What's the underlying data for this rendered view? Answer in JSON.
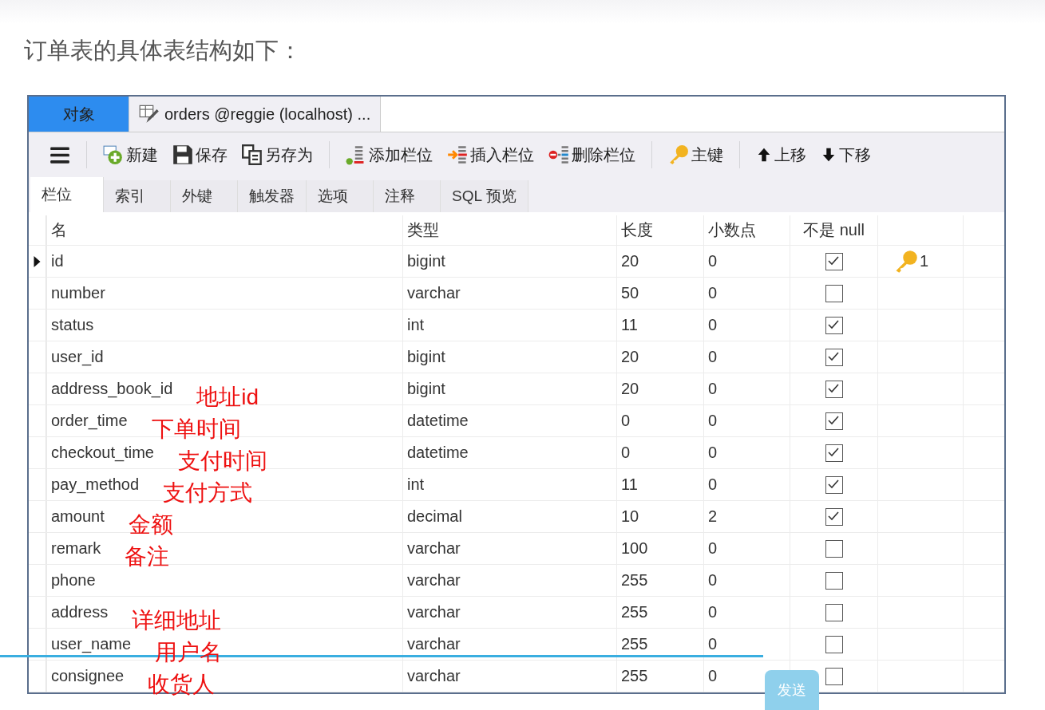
{
  "heading": "订单表的具体表结构如下：",
  "window": {
    "tabs": [
      {
        "label": "对象",
        "selected": true,
        "kind": "plain"
      },
      {
        "label": "orders @reggie (localhost) ...",
        "selected": false,
        "kind": "design"
      }
    ],
    "toolbar_groups": [
      [
        {
          "kind": "menu"
        }
      ],
      [
        {
          "kind": "new",
          "label": "新建"
        },
        {
          "kind": "save",
          "label": "保存"
        },
        {
          "kind": "saveas",
          "label": "另存为"
        }
      ],
      [
        {
          "kind": "addcol",
          "label": "添加栏位"
        },
        {
          "kind": "insertcol",
          "label": "插入栏位"
        },
        {
          "kind": "deletecol",
          "label": "删除栏位"
        }
      ],
      [
        {
          "kind": "key",
          "label": "主键"
        }
      ],
      [
        {
          "kind": "up",
          "label": "上移"
        },
        {
          "kind": "down",
          "label": "下移"
        }
      ]
    ],
    "subtabs": [
      {
        "label": "栏位",
        "selected": true
      },
      {
        "label": "索引",
        "selected": false
      },
      {
        "label": "外键",
        "selected": false
      },
      {
        "label": "触发器",
        "selected": false
      },
      {
        "label": "选项",
        "selected": false
      },
      {
        "label": "注释",
        "selected": false
      },
      {
        "label": "SQL 预览",
        "selected": false
      }
    ],
    "table": {
      "columns": [
        "名",
        "类型",
        "长度",
        "小数点",
        "不是 null"
      ],
      "rows": [
        {
          "name": "id",
          "type": "bigint",
          "length": "20",
          "decimals": "0",
          "not_null": true,
          "current": true,
          "key": "1"
        },
        {
          "name": "number",
          "type": "varchar",
          "length": "50",
          "decimals": "0",
          "not_null": false,
          "current": false
        },
        {
          "name": "status",
          "type": "int",
          "length": "11",
          "decimals": "0",
          "not_null": true,
          "current": false
        },
        {
          "name": "user_id",
          "type": "bigint",
          "length": "20",
          "decimals": "0",
          "not_null": true,
          "current": false
        },
        {
          "name": "address_book_id",
          "type": "bigint",
          "length": "20",
          "decimals": "0",
          "not_null": true,
          "current": false,
          "note": "地址id"
        },
        {
          "name": "order_time",
          "type": "datetime",
          "length": "0",
          "decimals": "0",
          "not_null": true,
          "current": false,
          "note": "下单时间"
        },
        {
          "name": "checkout_time",
          "type": "datetime",
          "length": "0",
          "decimals": "0",
          "not_null": true,
          "current": false,
          "note": "支付时间"
        },
        {
          "name": "pay_method",
          "type": "int",
          "length": "11",
          "decimals": "0",
          "not_null": true,
          "current": false,
          "note": "支付方式"
        },
        {
          "name": "amount",
          "type": "decimal",
          "length": "10",
          "decimals": "2",
          "not_null": true,
          "current": false,
          "note": "金额"
        },
        {
          "name": "remark",
          "type": "varchar",
          "length": "100",
          "decimals": "0",
          "not_null": false,
          "current": false,
          "note": "备注"
        },
        {
          "name": "phone",
          "type": "varchar",
          "length": "255",
          "decimals": "0",
          "not_null": false,
          "current": false
        },
        {
          "name": "address",
          "type": "varchar",
          "length": "255",
          "decimals": "0",
          "not_null": false,
          "current": false,
          "note": "详细地址"
        },
        {
          "name": "user_name",
          "type": "varchar",
          "length": "255",
          "decimals": "0",
          "not_null": false,
          "current": false,
          "note": "用户名"
        },
        {
          "name": "consignee",
          "type": "varchar",
          "length": "255",
          "decimals": "0",
          "not_null": false,
          "current": false,
          "note": "收货人"
        }
      ]
    }
  },
  "player": {
    "progress": {
      "level": 0.73
    },
    "send_button": "发送"
  }
}
